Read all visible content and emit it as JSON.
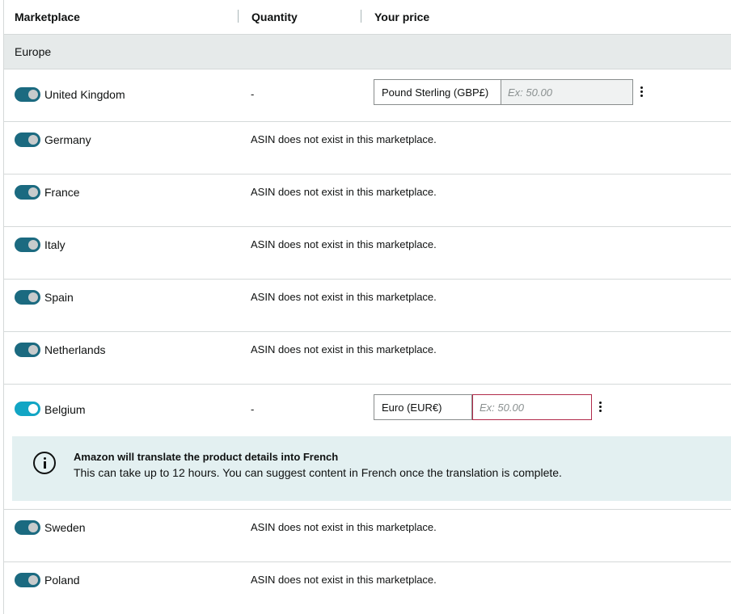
{
  "header": {
    "marketplace": "Marketplace",
    "quantity": "Quantity",
    "your_price": "Your price"
  },
  "group": {
    "label": "Europe"
  },
  "rows": [
    {
      "name": "United Kingdom",
      "enabled": true,
      "quantity": "-",
      "currency": "Pound Sterling (GBP£)",
      "price_placeholder": "Ex: 50.00"
    },
    {
      "name": "Germany",
      "enabled": true,
      "message": "ASIN does not exist in this marketplace."
    },
    {
      "name": "France",
      "enabled": true,
      "message": "ASIN does not exist in this marketplace."
    },
    {
      "name": "Italy",
      "enabled": true,
      "message": "ASIN does not exist in this marketplace."
    },
    {
      "name": "Spain",
      "enabled": true,
      "message": "ASIN does not exist in this marketplace."
    },
    {
      "name": "Netherlands",
      "enabled": true,
      "message": "ASIN does not exist in this marketplace."
    },
    {
      "name": "Belgium",
      "enabled": true,
      "quantity": "-",
      "currency": "Euro (EUR€)",
      "price_placeholder": "Ex: 50.00"
    },
    {
      "name": "Sweden",
      "enabled": true,
      "message": "ASIN does not exist in this marketplace."
    },
    {
      "name": "Poland",
      "enabled": true,
      "message": "ASIN does not exist in this marketplace."
    }
  ],
  "info": {
    "title": "Amazon will translate the product details into French",
    "body": "This can take up to 12 hours. You can suggest content in French once the translation is complete."
  },
  "colors": {
    "toggle_on": "#1b6a80",
    "toggle_active": "#12a5c4",
    "error_border": "#b12a4a",
    "info_bg": "#e3f0f1",
    "group_bg": "#e6eaea"
  }
}
